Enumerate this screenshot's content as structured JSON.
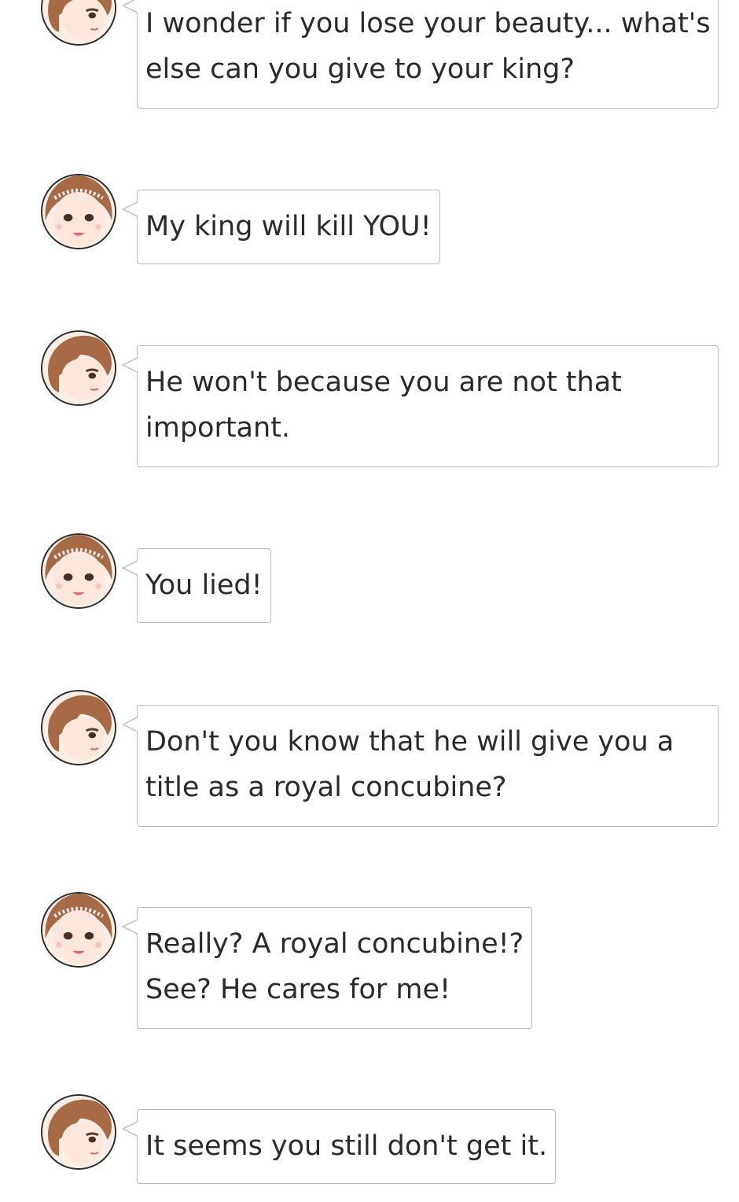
{
  "messages": [
    {
      "speaker": "rival",
      "avatar_icon": "rival-woman-avatar-icon",
      "lines": [
        "I wonder if you lose your beauty... what's",
        "else can you give to your king?"
      ]
    },
    {
      "speaker": "concubine",
      "avatar_icon": "pearl-tiara-woman-avatar-icon",
      "lines": [
        "My king will kill YOU!"
      ]
    },
    {
      "speaker": "rival",
      "avatar_icon": "rival-woman-avatar-icon",
      "lines": [
        "He won't because you are not that",
        "important."
      ]
    },
    {
      "speaker": "concubine",
      "avatar_icon": "pearl-tiara-woman-avatar-icon",
      "lines": [
        "You lied!"
      ]
    },
    {
      "speaker": "rival",
      "avatar_icon": "rival-woman-avatar-icon",
      "lines": [
        "Don't you know that he will give you a",
        "title as a royal concubine?"
      ]
    },
    {
      "speaker": "concubine",
      "avatar_icon": "pearl-tiara-woman-avatar-icon",
      "lines": [
        "Really? A royal concubine!?",
        "See? He cares for me!"
      ]
    },
    {
      "speaker": "rival",
      "avatar_icon": "rival-woman-avatar-icon",
      "lines": [
        "It seems you still don't get it."
      ]
    }
  ],
  "colors": {
    "bubble_border": "#b9b9b9",
    "text": "#2a2a2a",
    "hair_brown": "#a86a45",
    "background": "#ffffff"
  }
}
